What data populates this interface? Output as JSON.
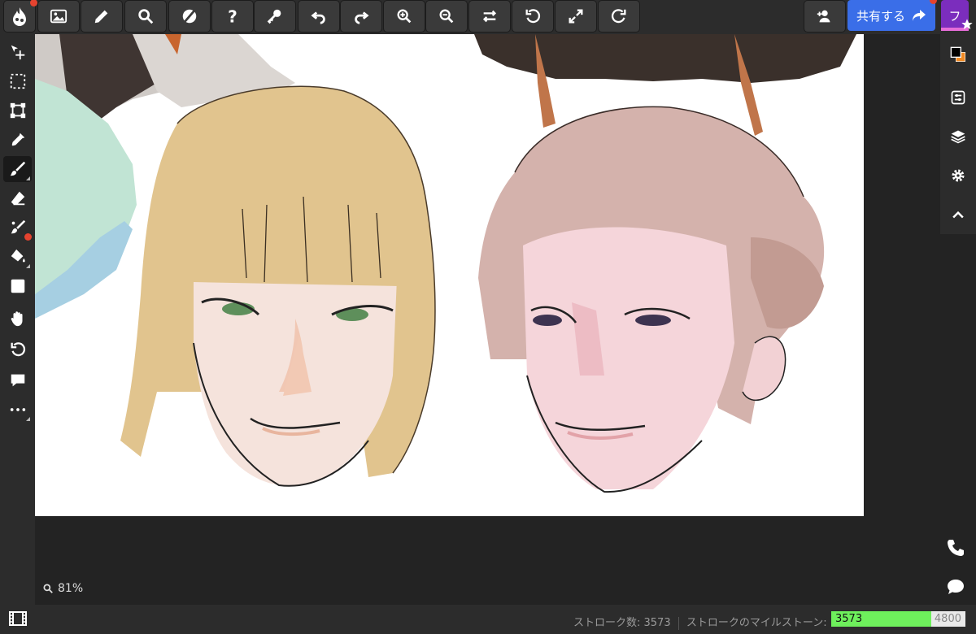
{
  "toolbar": {
    "share_label": "共有する",
    "user_initial": "フ",
    "buttons": [
      "gallery-icon",
      "pencil-icon",
      "search-icon",
      "contrast-icon",
      "help-icon",
      "key-icon",
      "undo-icon",
      "redo-icon",
      "zoom-in-icon",
      "zoom-out-icon",
      "flip-icon",
      "rotate-left-icon",
      "fullscreen-icon",
      "rotate-right-icon"
    ]
  },
  "left_tools": [
    "move-icon",
    "select-icon",
    "transform-icon",
    "eyedropper-icon",
    "brush-icon",
    "eraser-icon",
    "blend-icon",
    "fill-icon",
    "shape-icon",
    "hand-icon",
    "rotate-view-icon",
    "comment-icon",
    "more-icon"
  ],
  "active_tool": "brush-icon",
  "colors": {
    "primary": "#000000",
    "secondary": "#f08a24",
    "share_bg": "#3a6ee8",
    "progress": "#6ef05c"
  },
  "canvas": {
    "zoom_text": "81%"
  },
  "status": {
    "stroke_count_text": "ストローク数: 3573",
    "milestone_label": "ストロークのマイルストーン:",
    "current": "3573",
    "max": "4800",
    "progress_fraction": 0.744
  }
}
